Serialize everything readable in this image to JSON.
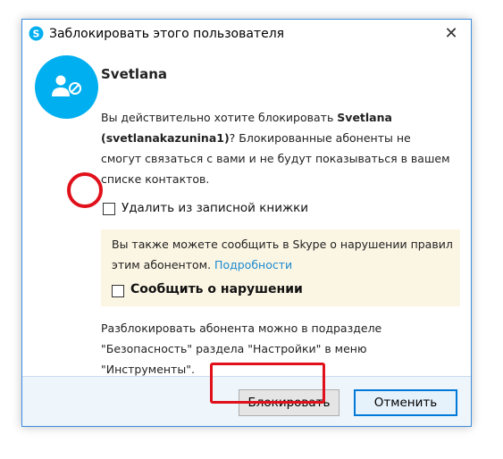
{
  "window": {
    "title": "Заблокировать этого пользователя",
    "close_glyph": "✕"
  },
  "user": {
    "display_name": "Svetlana"
  },
  "message": {
    "part1": "Вы действительно хотите блокировать ",
    "name": "Svetlana",
    "part2": " ",
    "login": "(svetlanakazunina1)",
    "part3": "? Блокированные абоненты не смогут связаться с вами и не будут показываться в вашем списке контактов."
  },
  "remove_contact": {
    "label": "Удалить из записной книжки",
    "checked": false
  },
  "report": {
    "text": "Вы также можете сообщить в Skype о нарушении правил этим абонентом.",
    "link": "Подробности",
    "checkbox_label": "Сообщить о нарушении",
    "checked": false
  },
  "unblock_hint": "Разблокировать абонента можно в подразделе \"Безопасность\" раздела \"Настройки\" в меню \"Инструменты\".",
  "buttons": {
    "block": "Блокировать",
    "cancel": "Отменить"
  },
  "icons": {
    "app": "skype-icon",
    "avatar": "blocked-user-icon"
  },
  "colors": {
    "accent": "#00aff0",
    "highlight": "#e0111b",
    "link": "#1a8ad1",
    "panel": "#fbf5e3"
  }
}
